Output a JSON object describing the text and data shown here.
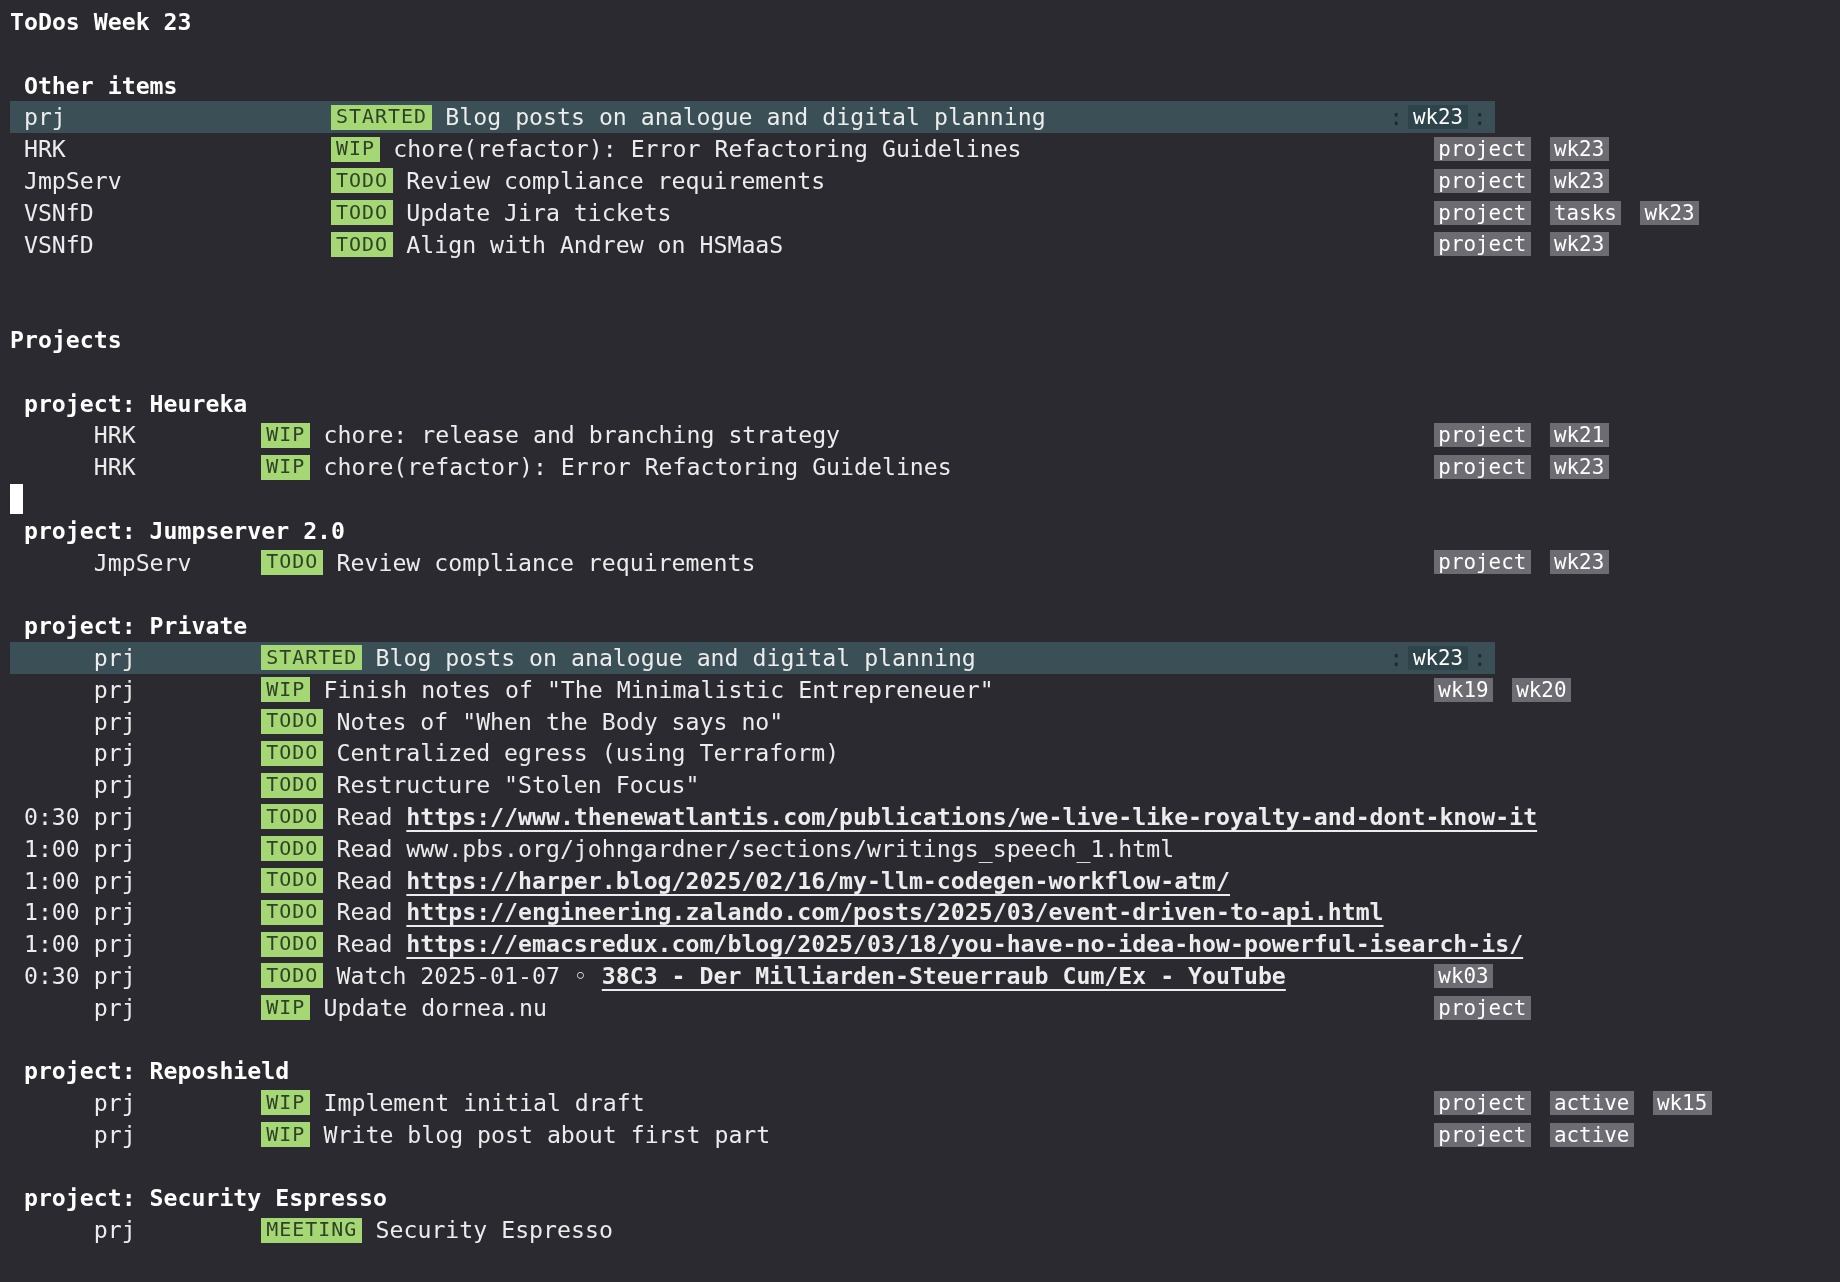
{
  "title": "ToDos Week 23",
  "sections": [
    {
      "kind": "flat",
      "heading": "Other items",
      "rows": [
        {
          "category": "prj",
          "keyword": "STARTED",
          "title": "Blog posts on analogue and digital planning",
          "tags": [
            "wk23"
          ],
          "tag_delimiter": ":",
          "highlighted": true
        },
        {
          "category": "HRK",
          "keyword": "WIP",
          "title": "chore(refactor): Error Refactoring Guidelines",
          "tags": [
            "project",
            "wk23"
          ],
          "highlighted": false
        },
        {
          "category": "JmpServ",
          "keyword": "TODO",
          "title": "Review compliance requirements",
          "tags": [
            "project",
            "wk23"
          ],
          "highlighted": false
        },
        {
          "category": "VSNfD",
          "keyword": "TODO",
          "title": "Update Jira tickets",
          "tags": [
            "project",
            "tasks",
            "wk23"
          ],
          "highlighted": false
        },
        {
          "category": "VSNfD",
          "keyword": "TODO",
          "title": "Align with Andrew on HSMaaS",
          "tags": [
            "project",
            "wk23"
          ],
          "highlighted": false
        }
      ]
    },
    {
      "kind": "projects",
      "heading": "Projects",
      "groups": [
        {
          "heading": "project: Heureka",
          "cursor_after": true,
          "rows": [
            {
              "category": "HRK",
              "keyword": "WIP",
              "title": "chore: release and branching strategy",
              "tags": [
                "project",
                "wk21"
              ],
              "highlighted": false
            },
            {
              "category": "HRK",
              "keyword": "WIP",
              "title": "chore(refactor): Error Refactoring Guidelines",
              "tags": [
                "project",
                "wk23"
              ],
              "highlighted": false
            }
          ]
        },
        {
          "heading": "project: Jumpserver 2.0",
          "cursor_after": false,
          "rows": [
            {
              "category": "JmpServ",
              "keyword": "TODO",
              "title": "Review compliance requirements",
              "tags": [
                "project",
                "wk23"
              ],
              "highlighted": false
            }
          ]
        },
        {
          "heading": "project: Private",
          "cursor_after": false,
          "rows": [
            {
              "category": "prj",
              "keyword": "STARTED",
              "title": "Blog posts on analogue and digital planning",
              "tags": [
                "wk23"
              ],
              "tag_delimiter": ":",
              "highlighted": true
            },
            {
              "category": "prj",
              "keyword": "WIP",
              "title": "Finish notes of \"The Minimalistic Entrepreneuer\"",
              "tags": [
                "wk19",
                "wk20"
              ],
              "highlighted": false
            },
            {
              "category": "prj",
              "keyword": "TODO",
              "title": "Notes of \"When the Body says no\"",
              "highlighted": false
            },
            {
              "category": "prj",
              "keyword": "TODO",
              "title": "Centralized egress (using Terraform)",
              "highlighted": false
            },
            {
              "category": "prj",
              "keyword": "TODO",
              "title": "Restructure \"Stolen Focus\"",
              "highlighted": false
            },
            {
              "time": "0:30",
              "category": "prj",
              "keyword": "TODO",
              "title": "Read",
              "link": "https://www.thenewatlantis.com/publications/we-live-like-royalty-and-dont-know-it",
              "highlighted": false
            },
            {
              "time": "1:00",
              "category": "prj",
              "keyword": "TODO",
              "title": "Read www.pbs.org/johngardner/sections/writings_speech_1.html",
              "highlighted": false
            },
            {
              "time": "1:00",
              "category": "prj",
              "keyword": "TODO",
              "title": "Read",
              "link": "https://harper.blog/2025/02/16/my-llm-codegen-workflow-atm/",
              "highlighted": false
            },
            {
              "time": "1:00",
              "category": "prj",
              "keyword": "TODO",
              "title": "Read",
              "link": "https://engineering.zalando.com/posts/2025/03/event-driven-to-api.html",
              "highlighted": false
            },
            {
              "time": "1:00",
              "category": "prj",
              "keyword": "TODO",
              "title": "Read",
              "link": "https://emacsredux.com/blog/2025/03/18/you-have-no-idea-how-powerful-isearch-is/",
              "highlighted": false
            },
            {
              "time": "0:30",
              "category": "prj",
              "keyword": "TODO",
              "title": "Watch 2025-01-07 ◦",
              "link": "38C3 - Der Milliarden-Steuerraub Cum/Ex - YouTube",
              "tags": [
                "wk03"
              ],
              "highlighted": false
            },
            {
              "category": "prj",
              "keyword": "WIP",
              "title": "Update dornea.nu",
              "tags": [
                "project"
              ],
              "highlighted": false
            }
          ]
        },
        {
          "heading": "project: Reposhield",
          "cursor_after": false,
          "rows": [
            {
              "category": "prj",
              "keyword": "WIP",
              "title": "Implement initial draft",
              "tags": [
                "project",
                "active",
                "wk15"
              ],
              "highlighted": false
            },
            {
              "category": "prj",
              "keyword": "WIP",
              "title": "Write blog post about first part",
              "tags": [
                "project",
                "active"
              ],
              "highlighted": false
            }
          ]
        },
        {
          "heading": "project: Security Espresso",
          "cursor_after": false,
          "rows": [
            {
              "category": "prj",
              "keyword": "MEETING",
              "title": "Security Espresso",
              "highlighted": false
            }
          ]
        }
      ]
    }
  ]
}
